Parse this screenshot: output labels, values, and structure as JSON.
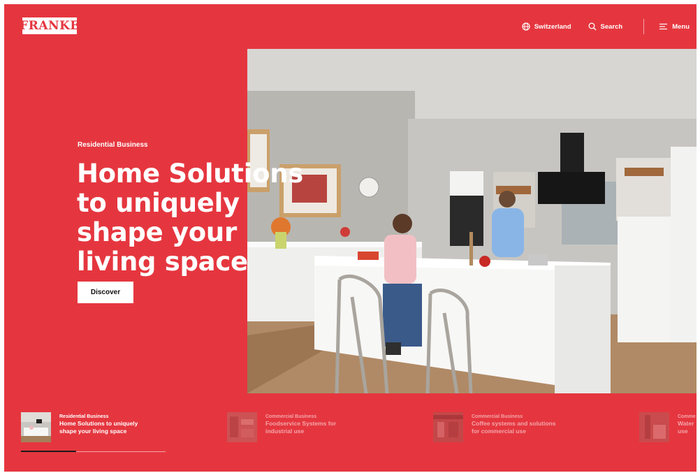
{
  "brand": {
    "logo_text": "FRANKE"
  },
  "colors": {
    "brand_red": "#e5363f",
    "white": "#ffffff"
  },
  "header": {
    "region_label": "Switzerland",
    "region_icon": "globe-icon",
    "search_label": "Search",
    "search_icon": "search-icon",
    "menu_label": "Menu",
    "menu_icon": "menu-icon"
  },
  "hero": {
    "eyebrow": "Residential Business",
    "headline_lines": [
      "Home Solutions",
      "to uniquely",
      "shape your",
      "living space"
    ],
    "cta_label": "Discover"
  },
  "slider": {
    "active_index": 0,
    "progress": 0.38,
    "slides": [
      {
        "category": "Residential Business",
        "title_lines": [
          "Home Solutions to uniquely",
          "shape your living space"
        ]
      },
      {
        "category": "Commercial Business",
        "title_lines": [
          "Foodservice Systems for",
          "industrial use"
        ]
      },
      {
        "category": "Commercial Business",
        "title_lines": [
          "Coffee systems and solutions",
          "for commercial use"
        ]
      },
      {
        "category": "Comme",
        "title_lines": [
          "Water",
          "use"
        ]
      }
    ]
  }
}
